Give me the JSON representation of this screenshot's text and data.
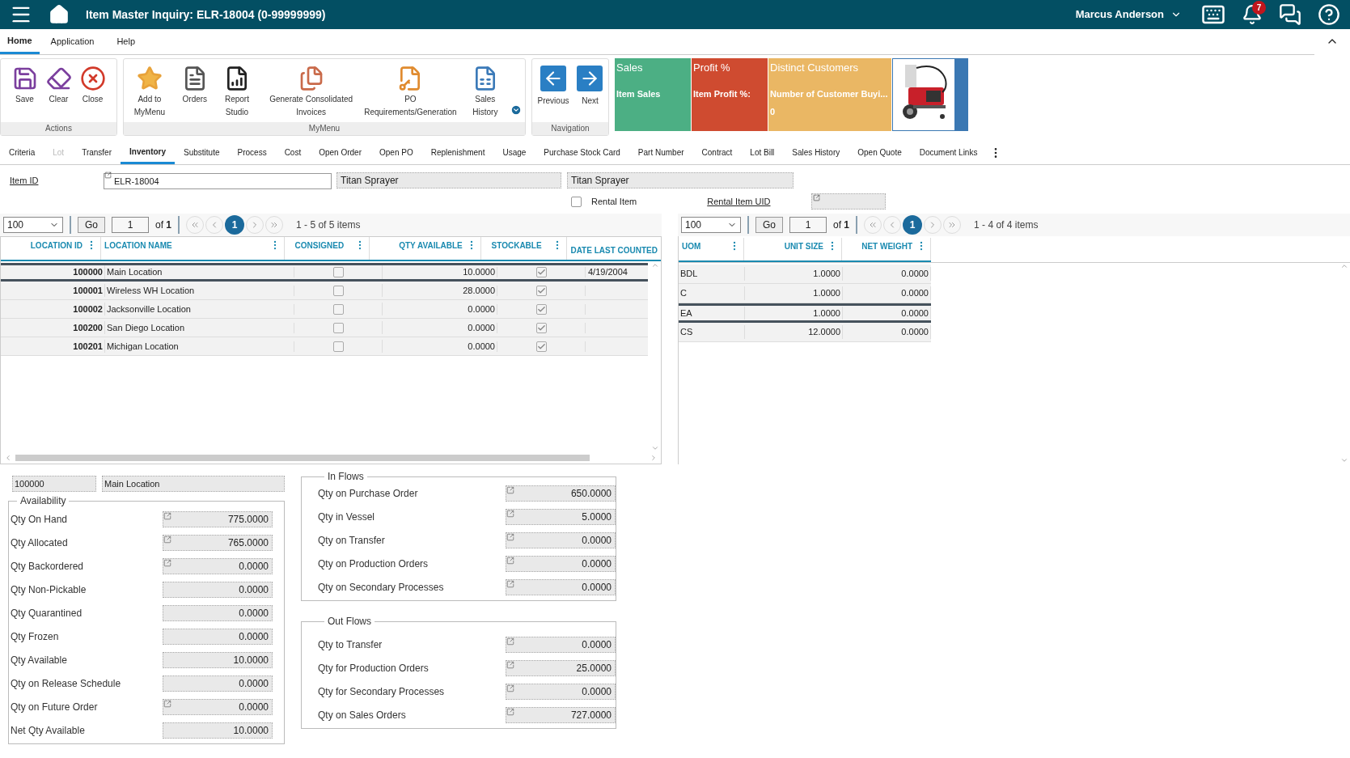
{
  "header": {
    "title": "Item Master Inquiry: ELR-18004 (0-99999999)",
    "user": "Marcus Anderson",
    "notification_count": "7"
  },
  "menu_tabs": [
    {
      "label": "Home",
      "selected": true
    },
    {
      "label": "Application",
      "selected": false
    },
    {
      "label": "Help",
      "selected": false
    }
  ],
  "ribbon_groups": [
    {
      "title": "Actions",
      "buttons": [
        {
          "label": "Save"
        },
        {
          "label": "Clear"
        },
        {
          "label": "Close"
        }
      ]
    },
    {
      "title": "MyMenu",
      "buttons": [
        {
          "label": "Add to MyMenu"
        },
        {
          "label": "Orders"
        },
        {
          "label": "Report Studio"
        },
        {
          "label": "Generate Consolidated Invoices"
        },
        {
          "label": "PO Requirements/Generation"
        },
        {
          "label": "Sales History"
        }
      ]
    },
    {
      "title": "Navigation",
      "buttons": [
        {
          "label": "Previous"
        },
        {
          "label": "Next"
        }
      ]
    }
  ],
  "kpi_tiles": [
    {
      "title": "Sales",
      "label": "Item Sales",
      "color": "#4caf84"
    },
    {
      "title": "Profit %",
      "label": "Item Profit %:",
      "color": "#cf4b30"
    },
    {
      "title": "Distinct Customers",
      "label": "Number of Customer Buyi...",
      "value": "0",
      "color": "#eab764"
    }
  ],
  "tabs": [
    {
      "label": "Criteria",
      "selected": false,
      "disabled": false
    },
    {
      "label": "Lot",
      "selected": false,
      "disabled": true
    },
    {
      "label": "Transfer",
      "selected": false,
      "disabled": false
    },
    {
      "label": "Inventory",
      "selected": true,
      "disabled": false
    },
    {
      "label": "Substitute",
      "selected": false,
      "disabled": false
    },
    {
      "label": "Process",
      "selected": false,
      "disabled": false
    },
    {
      "label": "Cost",
      "selected": false,
      "disabled": false
    },
    {
      "label": "Open Order",
      "selected": false,
      "disabled": false
    },
    {
      "label": "Open PO",
      "selected": false,
      "disabled": false
    },
    {
      "label": "Replenishment",
      "selected": false,
      "disabled": false
    },
    {
      "label": "Usage",
      "selected": false,
      "disabled": false
    },
    {
      "label": "Purchase Stock Card",
      "selected": false,
      "disabled": false
    },
    {
      "label": "Part Number",
      "selected": false,
      "disabled": false
    },
    {
      "label": "Contract",
      "selected": false,
      "disabled": false
    },
    {
      "label": "Lot Bill",
      "selected": false,
      "disabled": false
    },
    {
      "label": "Sales History",
      "selected": false,
      "disabled": false
    },
    {
      "label": "Open Quote",
      "selected": false,
      "disabled": false
    },
    {
      "label": "Document Links",
      "selected": false,
      "disabled": false
    }
  ],
  "item": {
    "id_label": "Item ID",
    "id_value": "ELR-18004",
    "description": "Titan Sprayer",
    "description_2": "Titan Sprayer",
    "rental_item": {
      "label": "Rental Item",
      "checked": false
    },
    "rental_uid_label": "Rental Item UID"
  },
  "locations_grid": {
    "pager": {
      "page_size": "100",
      "go": "Go",
      "page": "1",
      "of": "of **1**",
      "current": "1",
      "summary": "1 - 5 of 5 items"
    },
    "columns": [
      "LOCATION ID",
      "LOCATION NAME",
      "CONSIGNED",
      "QTY AVAILABLE",
      "STOCKABLE",
      "DATE LAST COUNTED"
    ],
    "rows": [
      {
        "location_id": "100000",
        "location_name": "Main Location",
        "consigned": false,
        "qty_available": "10.0000",
        "stockable": true,
        "date_last_counted": "4/19/2004",
        "selected": true
      },
      {
        "location_id": "100001",
        "location_name": "Wireless WH Location",
        "consigned": false,
        "qty_available": "28.0000",
        "stockable": true,
        "selected": false
      },
      {
        "location_id": "100002",
        "location_name": "Jacksonville Location",
        "consigned": false,
        "qty_available": "0.0000",
        "stockable": true,
        "selected": false
      },
      {
        "location_id": "100200",
        "location_name": "San Diego Location",
        "consigned": false,
        "qty_available": "0.0000",
        "stockable": true,
        "selected": false
      },
      {
        "location_id": "100201",
        "location_name": "Michigan Location",
        "consigned": false,
        "qty_available": "0.0000",
        "stockable": true,
        "selected": false
      }
    ]
  },
  "uom_grid": {
    "pager": {
      "page_size": "100",
      "go": "Go",
      "page": "1",
      "of": "of **1**",
      "current": "1",
      "summary": "1 - 4 of 4 items"
    },
    "columns": [
      "UOM",
      "UNIT SIZE",
      "NET WEIGHT"
    ],
    "rows": [
      {
        "uom": "BDL",
        "unit_size": "1.0000",
        "net_weight": "0.0000",
        "selected": false
      },
      {
        "uom": "C",
        "unit_size": "1.0000",
        "net_weight": "0.0000",
        "selected": false
      },
      {
        "uom": "EA",
        "unit_size": "1.0000",
        "net_weight": "0.0000",
        "selected": true
      },
      {
        "uom": "CS",
        "unit_size": "12.0000",
        "net_weight": "0.0000",
        "selected": false
      }
    ]
  },
  "selected_location": {
    "id": "100000",
    "name": "Main Location"
  },
  "availability": {
    "title": "Availability",
    "rows": [
      {
        "label": "Qty On Hand",
        "value": "775.0000",
        "linked": true
      },
      {
        "label": "Qty Allocated",
        "value": "765.0000",
        "linked": true
      },
      {
        "label": "Qty Backordered",
        "value": "0.0000",
        "linked": true
      },
      {
        "label": "Qty Non-Pickable",
        "value": "0.0000",
        "linked": false
      },
      {
        "label": "Qty Quarantined",
        "value": "0.0000",
        "linked": false
      },
      {
        "label": "Qty Frozen",
        "value": "0.0000",
        "linked": false
      },
      {
        "label": "Qty Available",
        "value": "10.0000",
        "linked": false
      },
      {
        "label": "Qty on Release Schedule",
        "value": "0.0000",
        "linked": false
      },
      {
        "label": "Qty on Future Order",
        "value": "0.0000",
        "linked": true
      },
      {
        "label": "Net Qty Available",
        "value": "10.0000",
        "linked": false
      }
    ]
  },
  "in_flows": {
    "title": "In Flows",
    "rows": [
      {
        "label": "Qty on Purchase Order",
        "value": "650.0000",
        "linked": true
      },
      {
        "label": "Qty in Vessel",
        "value": "5.0000",
        "linked": true
      },
      {
        "label": "Qty on Transfer",
        "value": "0.0000",
        "linked": true
      },
      {
        "label": "Qty on Production Orders",
        "value": "0.0000",
        "linked": true
      },
      {
        "label": "Qty on Secondary Processes",
        "value": "0.0000",
        "linked": true
      }
    ]
  },
  "out_flows": {
    "title": "Out Flows",
    "rows": [
      {
        "label": "Qty to Transfer",
        "value": "0.0000",
        "linked": true
      },
      {
        "label": "Qty for Production Orders",
        "value": "25.0000",
        "linked": true
      },
      {
        "label": "Qty for Secondary Processes",
        "value": "0.0000",
        "linked": true
      },
      {
        "label": "Qty on Sales Orders",
        "value": "727.0000",
        "linked": true
      }
    ]
  }
}
